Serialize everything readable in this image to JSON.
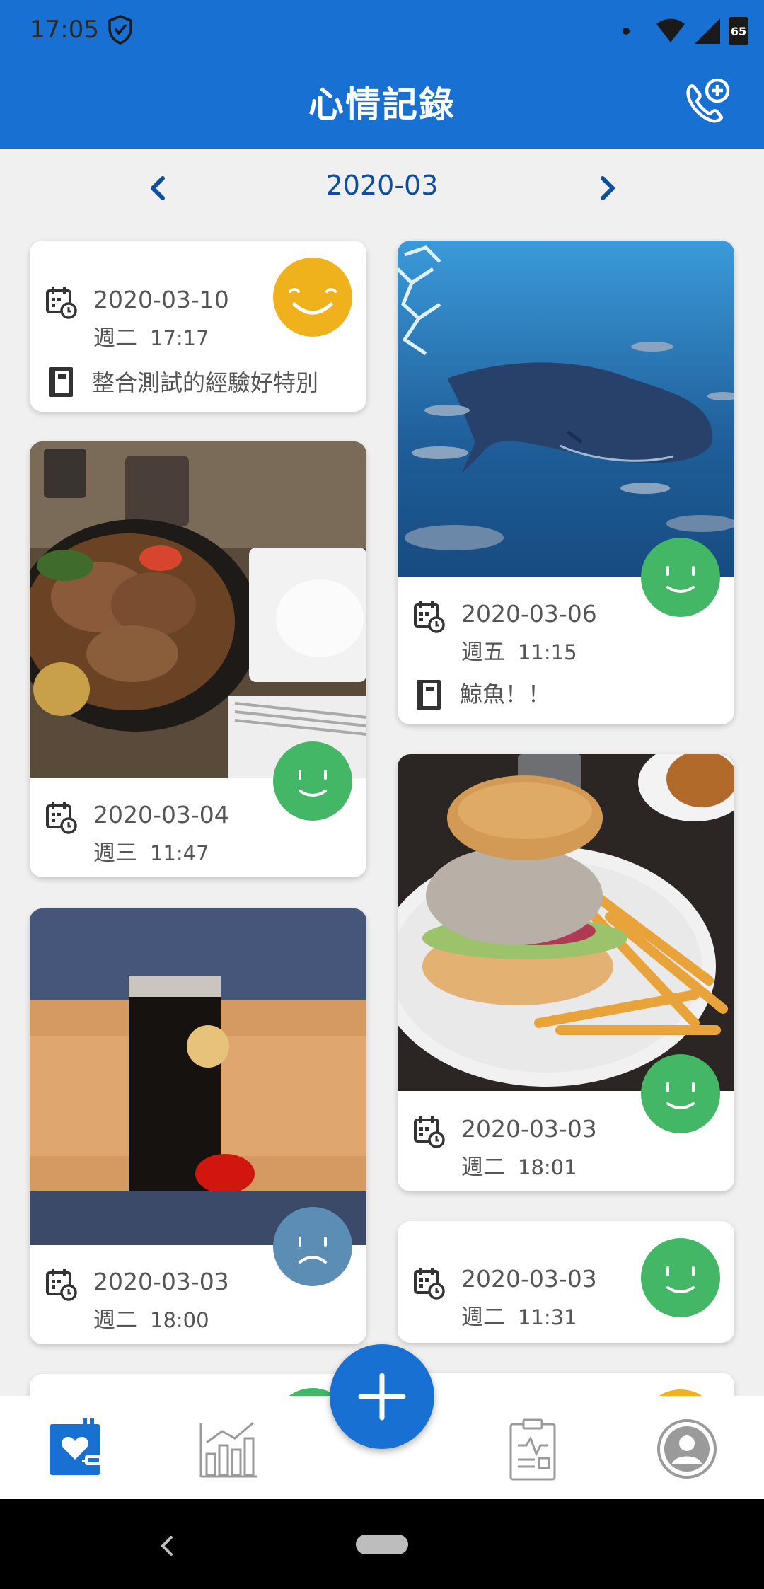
{
  "status_bar": {
    "time": "17:05",
    "battery": "65"
  },
  "app_bar": {
    "title": "心情記錄"
  },
  "month_nav": {
    "month": "2020-03"
  },
  "entries": [
    {
      "date": "2020-03-10",
      "weekday": "週二",
      "time": "17:17",
      "note": "整合測試的經驗好特別",
      "mood": "happy",
      "mood_color": "#f0b21c"
    },
    {
      "date": "2020-03-06",
      "weekday": "週五",
      "time": "11:15",
      "note": "鯨魚！！",
      "mood": "smile",
      "mood_color": "#43b765"
    },
    {
      "date": "2020-03-04",
      "weekday": "週三",
      "time": "11:47",
      "mood": "smile",
      "mood_color": "#43b765"
    },
    {
      "date": "2020-03-03",
      "weekday": "週二",
      "time": "18:01",
      "mood": "smile",
      "mood_color": "#43b765"
    },
    {
      "date": "2020-03-03",
      "weekday": "週二",
      "time": "18:00",
      "mood": "sad",
      "mood_color": "#5b8db5"
    },
    {
      "date": "2020-03-03",
      "weekday": "週二",
      "time": "11:31",
      "mood": "smile",
      "mood_color": "#43b765"
    }
  ],
  "colors": {
    "primary": "#1871d2",
    "happy": "#f0b21c",
    "smile": "#43b765",
    "sad": "#5b8db5"
  },
  "bottom_nav": [
    "diary-icon",
    "chart-icon",
    "add-icon",
    "report-icon",
    "profile-icon"
  ]
}
